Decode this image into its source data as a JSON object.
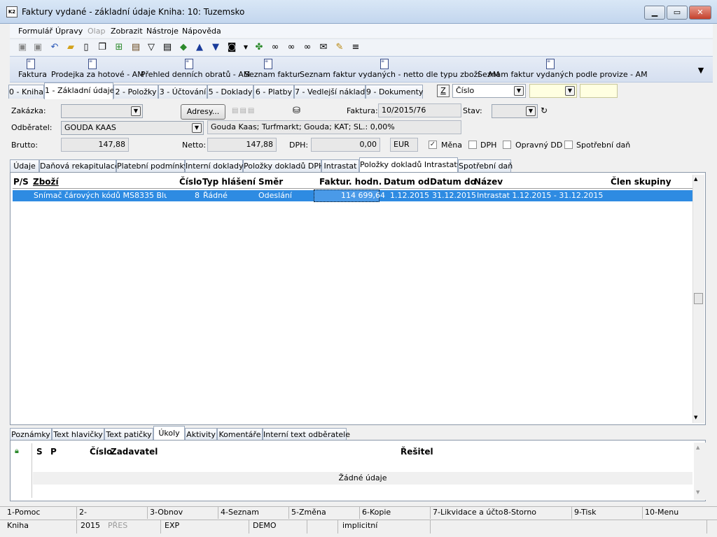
{
  "window": {
    "title": "Faktury vydané - základní údaje",
    "book": "Kniha: 10: Tuzemsko",
    "app_icon": "K2"
  },
  "menu": [
    "Formulář",
    "Úpravy",
    "Olap",
    "Zobrazit",
    "Nástroje",
    "Nápověda"
  ],
  "reports": [
    "Faktura",
    "Prodejka za hotové - AM",
    "Přehled denních obratů - AM",
    "Seznam faktur",
    "Seznam faktur vydaných - netto dle typu zboží - AM",
    "Seznam faktur vydaných podle provize - AM"
  ],
  "main_tabs": [
    "0 - Kniha",
    "1 - Základní údaje",
    "2 - Položky",
    "3 - Účtování",
    "5 - Doklady",
    "6 - Platby",
    "7 - Vedlejší náklady",
    "9 - Dokumenty"
  ],
  "sort": {
    "z_label": "Z",
    "field": "Číslo"
  },
  "form": {
    "zakazka_label": "Zakázka:",
    "adresy_button": "Adresy...",
    "faktura_label": "Faktura:",
    "faktura_value": "10/2015/76",
    "stav_label": "Stav:",
    "odberatel_label": "Odběratel:",
    "odberatel_value": "GOUDA KAAS",
    "odberatel_info": "Gouda Kaas; Turfmarkt; Gouda; KAT; SL.: 0,00%",
    "brutto_label": "Brutto:",
    "brutto_value": "147,88",
    "netto_label": "Netto:",
    "netto_value": "147,88",
    "dph_label": "DPH:",
    "dph_value": "0,00",
    "currency": "EUR",
    "mena_label": "Měna",
    "dph_check_label": "DPH",
    "opravny_label": "Opravný DD",
    "spotrebni_label": "Spotřební daň"
  },
  "sub_tabs": [
    "Údaje",
    "Daňová rekapitulace",
    "Platební podmínky",
    "Interní doklady",
    "Položky dokladů DPH",
    "Intrastat",
    "Položky dokladů Intrastatu",
    "Spotřební daň"
  ],
  "grid": {
    "columns": [
      "P/S",
      "Zboží",
      "Číslo",
      "Typ hlášení",
      "Směr",
      "Faktur. hodn.",
      "Datum od",
      "Datum do",
      "Název",
      "Člen skupiny"
    ],
    "rows": [
      {
        "ps": "",
        "zbozi": "Snímač čárových kódů MS8335 Bluet...",
        "cislo": "8",
        "typ": "Řádné",
        "smer": "Odeslání",
        "hodnota": "114 699,64",
        "od": "1.12.2015",
        "do": "31.12.2015",
        "nazev": "Intrastat 1.12.2015 - 31.12.2015",
        "clen": ""
      }
    ]
  },
  "bottom_tabs": [
    "Poznámky",
    "Text hlavičky",
    "Text patičky",
    "Úkoly",
    "Aktivity",
    "Komentáře",
    "Interní text odběratele"
  ],
  "tasks": {
    "columns": [
      "S",
      "P",
      "Číslo",
      "Zadavatel",
      "Řešitel"
    ],
    "empty": "Žádné údaje"
  },
  "fkeys": [
    "1-Pomoc",
    "2-",
    "3-Obnov",
    "4-Seznam",
    "5-Změna",
    "6-Kopie",
    "7-Likvidace a účtová",
    "8-Storno",
    "9-Tisk",
    "10-Menu"
  ],
  "status": {
    "kniha": "Kniha",
    "rok": "2015",
    "pres": "PŘES",
    "exp": "EXP",
    "demo": "DEMO",
    "implicitni": "implicitní"
  },
  "colors": {
    "selection": "#2e8be2",
    "accent": "#c3d6ee"
  }
}
